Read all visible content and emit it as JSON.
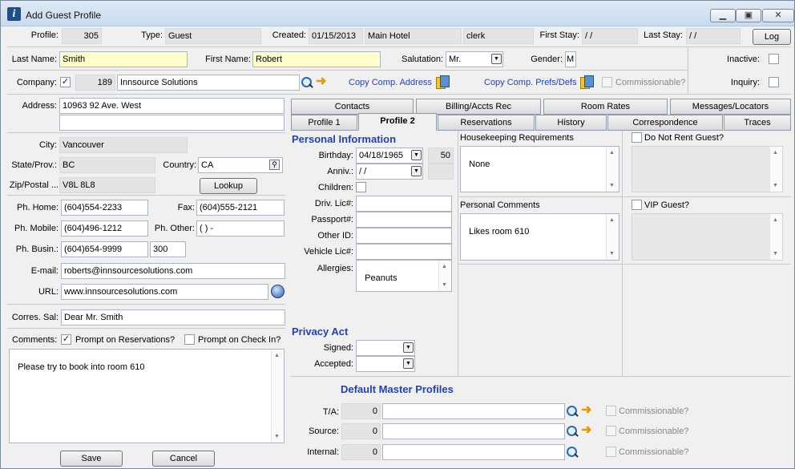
{
  "window": {
    "title": "Add Guest Profile"
  },
  "header": {
    "profile_label": "Profile:",
    "profile_value": "305",
    "type_label": "Type:",
    "type_value": "Guest",
    "created_label": "Created:",
    "created_date": "01/15/2013",
    "created_hotel": "Main Hotel",
    "created_user": "clerk",
    "first_stay_label": "First Stay:",
    "first_stay_value": "/ /",
    "last_stay_label": "Last Stay:",
    "last_stay_value": "/ /",
    "log_button": "Log"
  },
  "name": {
    "last_label": "Last Name:",
    "last_value": "Smith",
    "first_label": "First Name:",
    "first_value": "Robert",
    "salutation_label": "Salutation:",
    "salutation_value": "Mr.",
    "gender_label": "Gender:",
    "gender_value": "M"
  },
  "flags": {
    "inactive_label": "Inactive:",
    "inquiry_label": "Inquiry:"
  },
  "company": {
    "label": "Company:",
    "id": "189",
    "name": "Innsource Solutions",
    "copy_address": "Copy Comp. Address",
    "copy_prefs": "Copy Comp. Prefs/Defs",
    "commissionable": "Commissionable?"
  },
  "address": {
    "label": "Address:",
    "line1": "10963 92 Ave. West",
    "line2": "",
    "city_label": "City:",
    "city": "Vancouver",
    "state_label": "State/Prov.:",
    "state": "BC",
    "country_label": "Country:",
    "country": "CA",
    "zip_label": "Zip/Postal ...",
    "zip": "V8L 8L8",
    "lookup_button": "Lookup"
  },
  "phones": {
    "home_label": "Ph. Home:",
    "home": "(604)554-2233",
    "fax_label": "Fax:",
    "fax": "(604)555-2121",
    "mobile_label": "Ph. Mobile:",
    "mobile": "(604)496-1212",
    "other_label": "Ph. Other:",
    "other": "(   )   -",
    "business_label": "Ph. Busin.:",
    "business": "(604)654-9999",
    "business_ext": "300"
  },
  "contact": {
    "email_label": "E-mail:",
    "email": "roberts@innsourcesolutions.com",
    "url_label": "URL:",
    "url": "www.innsourcesolutions.com",
    "corres_label": "Corres. Sal:",
    "corres": "Dear Mr. Smith"
  },
  "comments": {
    "label": "Comments:",
    "prompt_reservations": "Prompt on Reservations?",
    "prompt_checkin": "Prompt on Check In?",
    "text": "Please try to book into room 610"
  },
  "buttons": {
    "save": "Save",
    "cancel": "Cancel"
  },
  "tabs_row1": [
    "Contacts",
    "Billing/Accts Rec",
    "Room Rates",
    "Messages/Locators"
  ],
  "tabs_row2": [
    "Profile 1",
    "Profile 2",
    "Reservations",
    "History",
    "Correspondence",
    "Traces"
  ],
  "personal": {
    "heading": "Personal Information",
    "birthday_label": "Birthday:",
    "birthday": "04/18/1965",
    "age": "50",
    "anniv_label": "Anniv.:",
    "anniv": "/ /",
    "children_label": "Children:",
    "driv_label": "Driv. Lic#:",
    "passport_label": "Passport#:",
    "other_id_label": "Other ID:",
    "vehicle_label": "Vehicle Lic#:",
    "allergies_label": "Allergies:",
    "allergies": "Peanuts"
  },
  "housekeeping": {
    "label": "Housekeeping Requirements",
    "text": "None"
  },
  "personal_comments": {
    "label": "Personal Comments",
    "text": "Likes room 610"
  },
  "do_not_rent": {
    "label": "Do Not Rent Guest?"
  },
  "vip": {
    "label": "VIP Guest?"
  },
  "privacy": {
    "heading": "Privacy Act",
    "signed_label": "Signed:",
    "accepted_label": "Accepted:"
  },
  "master": {
    "heading": "Default Master Profiles",
    "ta_label": "T/A:",
    "ta_id": "0",
    "source_label": "Source:",
    "source_id": "0",
    "internal_label": "Internal:",
    "internal_id": "0",
    "commissionable": "Commissionable?"
  }
}
